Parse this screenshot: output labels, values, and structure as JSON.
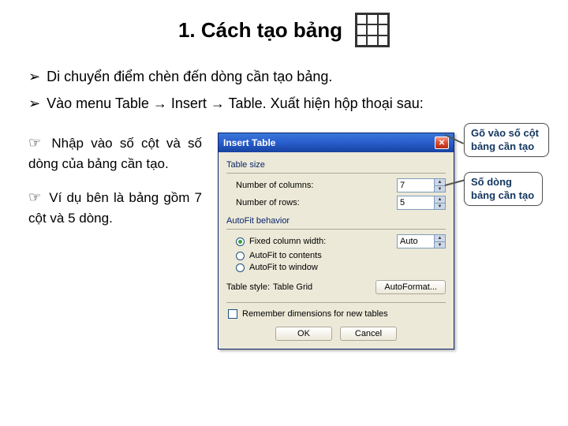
{
  "title": "1. Cách tạo bảng",
  "bullets": {
    "b1": "Di chuyển điểm chèn đến dòng cần tạo bảng.",
    "b2": "Vào menu Table → Insert → Table. Xuất hiện hộp thoại sau:"
  },
  "left": {
    "p1": "Nhập vào số cột và số dòng của bảng cần tạo.",
    "p2": "Ví dụ bên là bảng gồm 7 cột và 5 dòng."
  },
  "dialog": {
    "title": "Insert Table",
    "group_size": "Table size",
    "cols_label": "Number of columns:",
    "cols_value": "7",
    "rows_label": "Number of rows:",
    "rows_value": "5",
    "group_autofit": "AutoFit behavior",
    "opt_fixed": "Fixed column width:",
    "fixed_value": "Auto",
    "opt_contents": "AutoFit to contents",
    "opt_window": "AutoFit to window",
    "style_label": "Table style:",
    "style_value": "Table Grid",
    "autoformat_btn": "AutoFormat...",
    "remember": "Remember dimensions for new tables",
    "ok": "OK",
    "cancel": "Cancel"
  },
  "callouts": {
    "c1": "Gõ vào số cột bảng cần tạo",
    "c2": "Số dòng bảng cần tạo"
  }
}
